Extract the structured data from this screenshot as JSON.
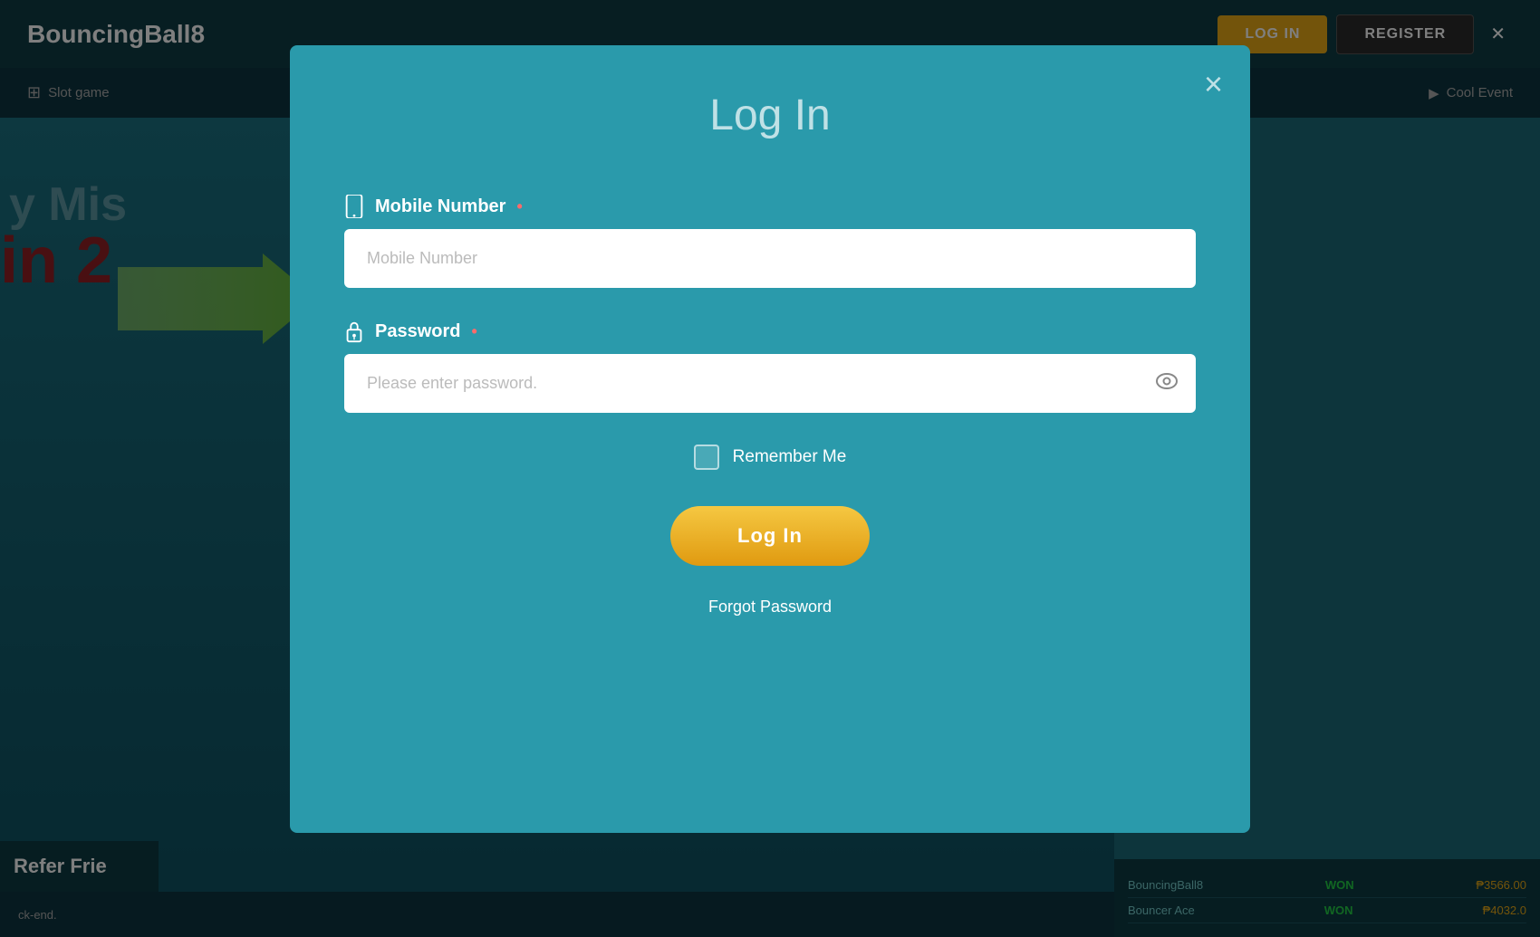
{
  "brand": {
    "name": "BouncingBall8",
    "superscript": "8"
  },
  "topNav": {
    "loginButton": "LOG IN",
    "registerButton": "REGISTER"
  },
  "subNav": {
    "slotGame": "Slot game",
    "coolEvent": "Cool Event"
  },
  "modal": {
    "title": "Log In",
    "closeLabel": "×",
    "mobileField": {
      "label": "Mobile Number",
      "placeholder": "Mobile Number",
      "requiredDot": "•"
    },
    "passwordField": {
      "label": "Password",
      "placeholder": "Please enter password.",
      "requiredDot": "•"
    },
    "rememberMe": "Remember Me",
    "loginButton": "Log In",
    "forgotPassword": "Forgot Password"
  },
  "leftContent": {
    "line1": "y Mis",
    "line2": "in 2"
  },
  "bottomContent": {
    "items": [
      {
        "site": "BouncingBall8",
        "status": "WON",
        "amount": "₱3566.00"
      },
      {
        "site": "Bouncer Ace",
        "status": "WON",
        "amount": "₱4032.0"
      }
    ]
  },
  "referBanner": {
    "text": "Refer Frie"
  },
  "ticker": {
    "text": "ck-end."
  },
  "colors": {
    "modalBg": "#2a9aab",
    "loginBtnGradientStart": "#f5c842",
    "loginBtnGradientEnd": "#e09a10",
    "requiredDot": "#ff6b6b"
  }
}
